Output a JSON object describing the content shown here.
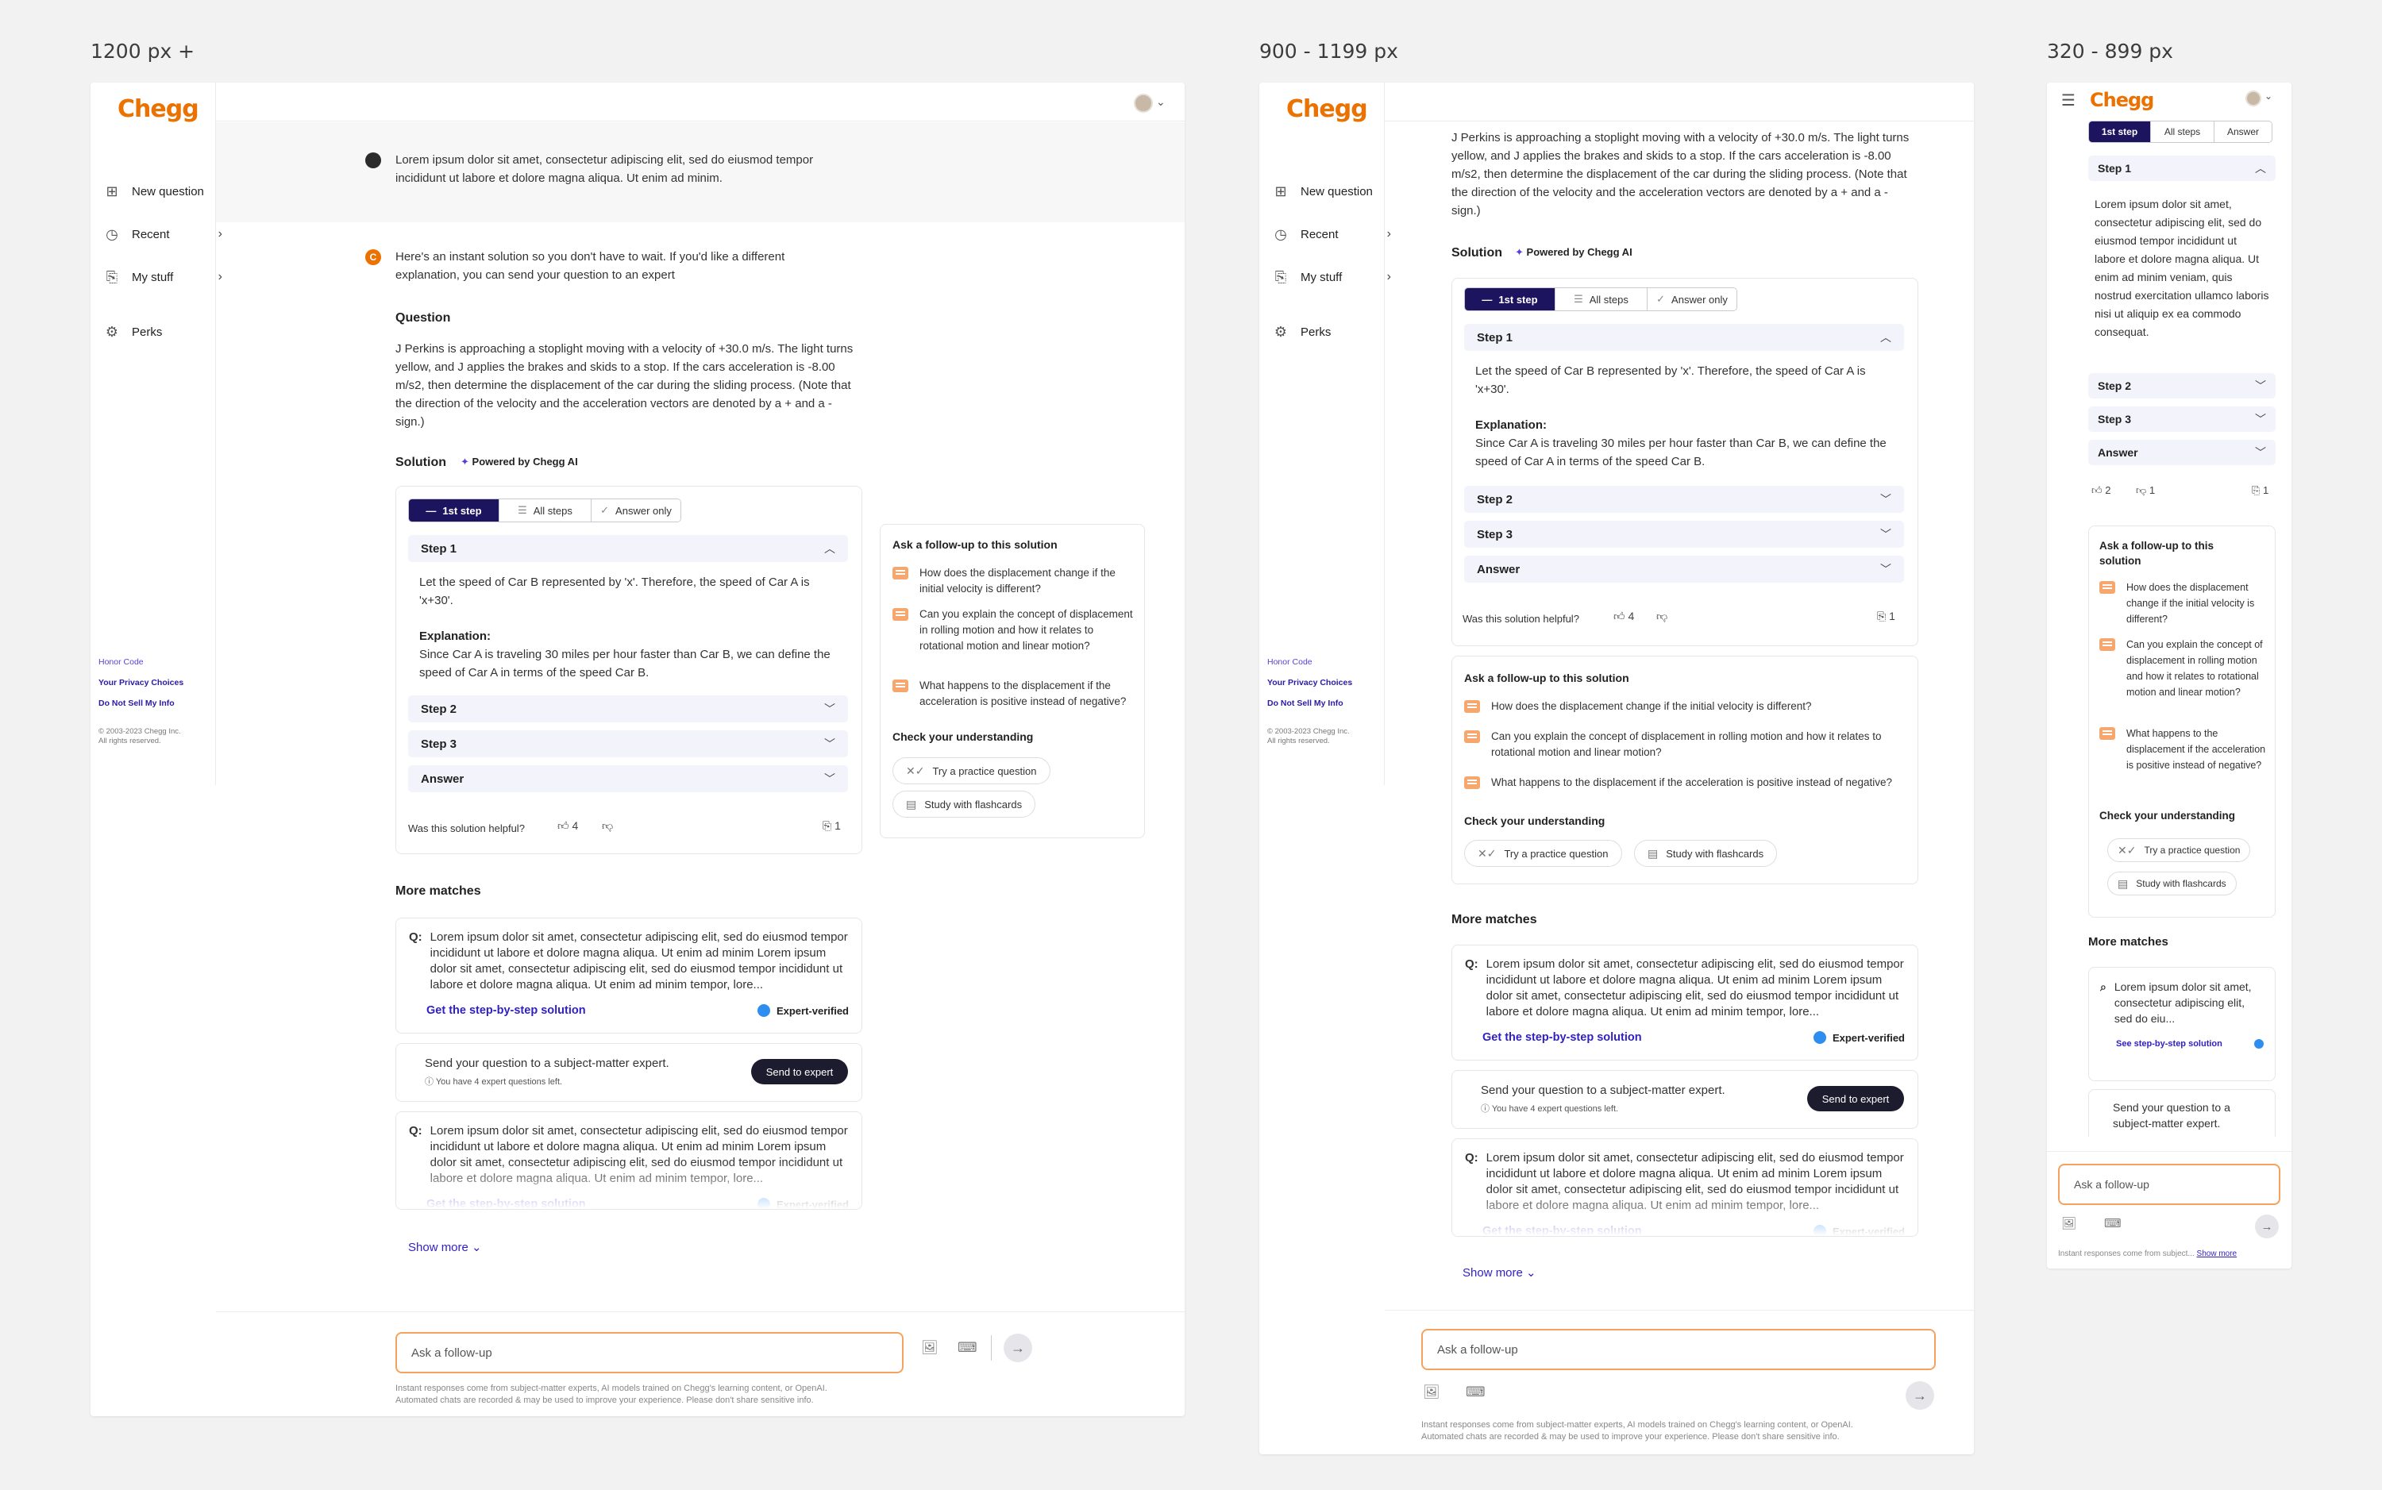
{
  "labels": {
    "wide": "1200 px +",
    "medium": "900 - 1199 px",
    "narrow": "320 - 899 px"
  },
  "brand": {
    "logo": "Chegg",
    "color": "#eb7100",
    "accent": "#1d1460",
    "link": "#2f1fc4"
  },
  "sidebar": {
    "new_question": "New question",
    "recent": "Recent",
    "my_stuff": "My stuff",
    "perks": "Perks",
    "honor_code": "Honor Code",
    "privacy": "Your Privacy Choices",
    "do_not_sell": "Do Not Sell My Info",
    "copyright_1": "© 2003-2023 Chegg Inc.",
    "copyright_2": "All rights reserved."
  },
  "user_message": "Lorem ipsum dolor sit amet, consectetur adipiscing elit, sed do eiusmod tempor incididunt ut labore et dolore magna aliqua. Ut enim ad minim.",
  "intro": "Here's an instant solution so you don't have to wait. If you'd like a different explanation, you can send your question to an expert",
  "question_heading": "Question",
  "question": "J Perkins is approaching a stoplight moving with a velocity of +30.0 m/s. The light turns yellow, and J applies the brakes and skids to a stop. If the cars acceleration is -8.00 m/s2, then determine the displacement of the car during the sliding process. (Note that the direction of the velocity and the acceleration vectors are denoted by a + and a - sign.)",
  "solution_heading": "Solution",
  "powered": "Powered by Chegg AI",
  "tabs": {
    "first": "1st step",
    "all": "All steps",
    "answer_only": "Answer only",
    "answer_short": "Answer"
  },
  "steps": {
    "step1": "Step 1",
    "step1_text": "Let the speed of Car B represented by 'x'. Therefore, the speed of Car A is 'x+30'.",
    "explanation_label": "Explanation:",
    "explanation": "Since Car A is traveling 30 miles per hour faster than Car B, we can define the speed of Car A in terms of the speed Car B.",
    "step2": "Step 2",
    "step3": "Step 3",
    "answer": "Answer",
    "mobile_step1_text": "Lorem ipsum dolor sit amet, consectetur adipiscing elit, sed do eiusmod tempor incididunt ut labore et dolore magna aliqua. Ut enim ad minim veniam, quis nostrud exercitation ullamco laboris nisi ut aliquip ex ea commodo consequat."
  },
  "helpful": {
    "question": "Was this solution helpful?",
    "likes": "4",
    "bookmarks": "1",
    "mobile_likes": "2",
    "mobile_dislikes": "1"
  },
  "followup": {
    "heading": "Ask a follow-up to this solution",
    "q1": "How does the displacement change if the initial velocity is different?",
    "q2": "Can you explain the concept of displacement in rolling motion and how it relates to rotational motion and linear motion?",
    "q3": "What happens to the displacement if the acceleration is positive instead of negative?",
    "check_heading": "Check your understanding",
    "practice": "Try a practice question",
    "flashcards": "Study with flashcards"
  },
  "more": {
    "heading": "More matches",
    "q_label": "Q:",
    "q_text": "Lorem ipsum dolor sit amet, consectetur adipiscing elit, sed do eiusmod tempor incididunt ut labore et dolore magna aliqua. Ut enim ad minim Lorem ipsum dolor sit amet, consectetur adipiscing elit, sed do eiusmod tempor incididunt ut labore et dolore magna aliqua. Ut enim ad minim tempor, lore...",
    "mobile_q_text": "Lorem ipsum dolor sit amet, consectetur adipiscing elit, sed do eiu...",
    "get_solution": "Get the step-by-step solution",
    "see_solution": "See step-by-step solution",
    "verified": "Expert-verified",
    "expert_prompt": "Send your question to a subject-matter expert.",
    "expert_left": "You have 4 expert questions left.",
    "send_expert": "Send to expert",
    "show_more": "Show more"
  },
  "composer": {
    "placeholder": "Ask a follow-up",
    "disclaimer_1": "Instant responses come from subject-matter experts, AI models trained on Chegg's learning content, or OpenAI.",
    "disclaimer_2": "Automated chats are recorded & may be used to improve your experience. Please don't share sensitive info.",
    "mobile_disclaimer": "Instant responses come from subject...",
    "mobile_show_more": "Show more"
  }
}
